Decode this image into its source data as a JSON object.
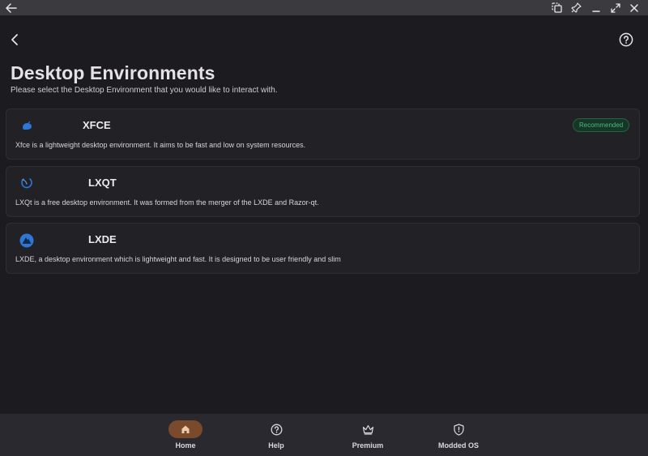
{
  "page": {
    "title": "Desktop Environments",
    "subtitle": "Please select the Desktop Environment that you would like to interact with."
  },
  "titlebar": {
    "icons": [
      "back-arrow-icon",
      "screenshot-icon",
      "pin-icon",
      "minimize-icon",
      "maximize-icon",
      "close-icon"
    ]
  },
  "header": {
    "back_icon": "chevron-left-icon",
    "help_icon": "help-circle-icon"
  },
  "environments": [
    {
      "name": "XFCE",
      "description": "Xfce is a lightweight desktop environment. It aims to be fast and low on system resources.",
      "badge": "Recommended",
      "icon": "xfce-mouse-icon"
    },
    {
      "name": "LXQT",
      "description": "LXQt is a free desktop environment. It was formed from the merger of the LXDE and Razor-qt.",
      "icon": "lxqt-logo-icon"
    },
    {
      "name": "LXDE",
      "description": "LXDE, a desktop environment which is lightweight and fast. It is designed to be user friendly and slim",
      "icon": "lxde-logo-icon"
    }
  ],
  "nav": {
    "items": [
      {
        "label": "Home",
        "icon": "home-icon",
        "active": true
      },
      {
        "label": "Help",
        "icon": "help-icon",
        "active": false
      },
      {
        "label": "Premium",
        "icon": "crown-icon",
        "active": false
      },
      {
        "label": "Modded OS",
        "icon": "shield-icon",
        "active": false
      }
    ]
  },
  "colors": {
    "background": "#1c1b20",
    "card": "#222126",
    "titlebar": "#3a3a3f",
    "nav": "#29292f",
    "nav_active": "#7a4a2d",
    "badge_text": "#55b483",
    "brand_blue": "#2f77d6"
  }
}
